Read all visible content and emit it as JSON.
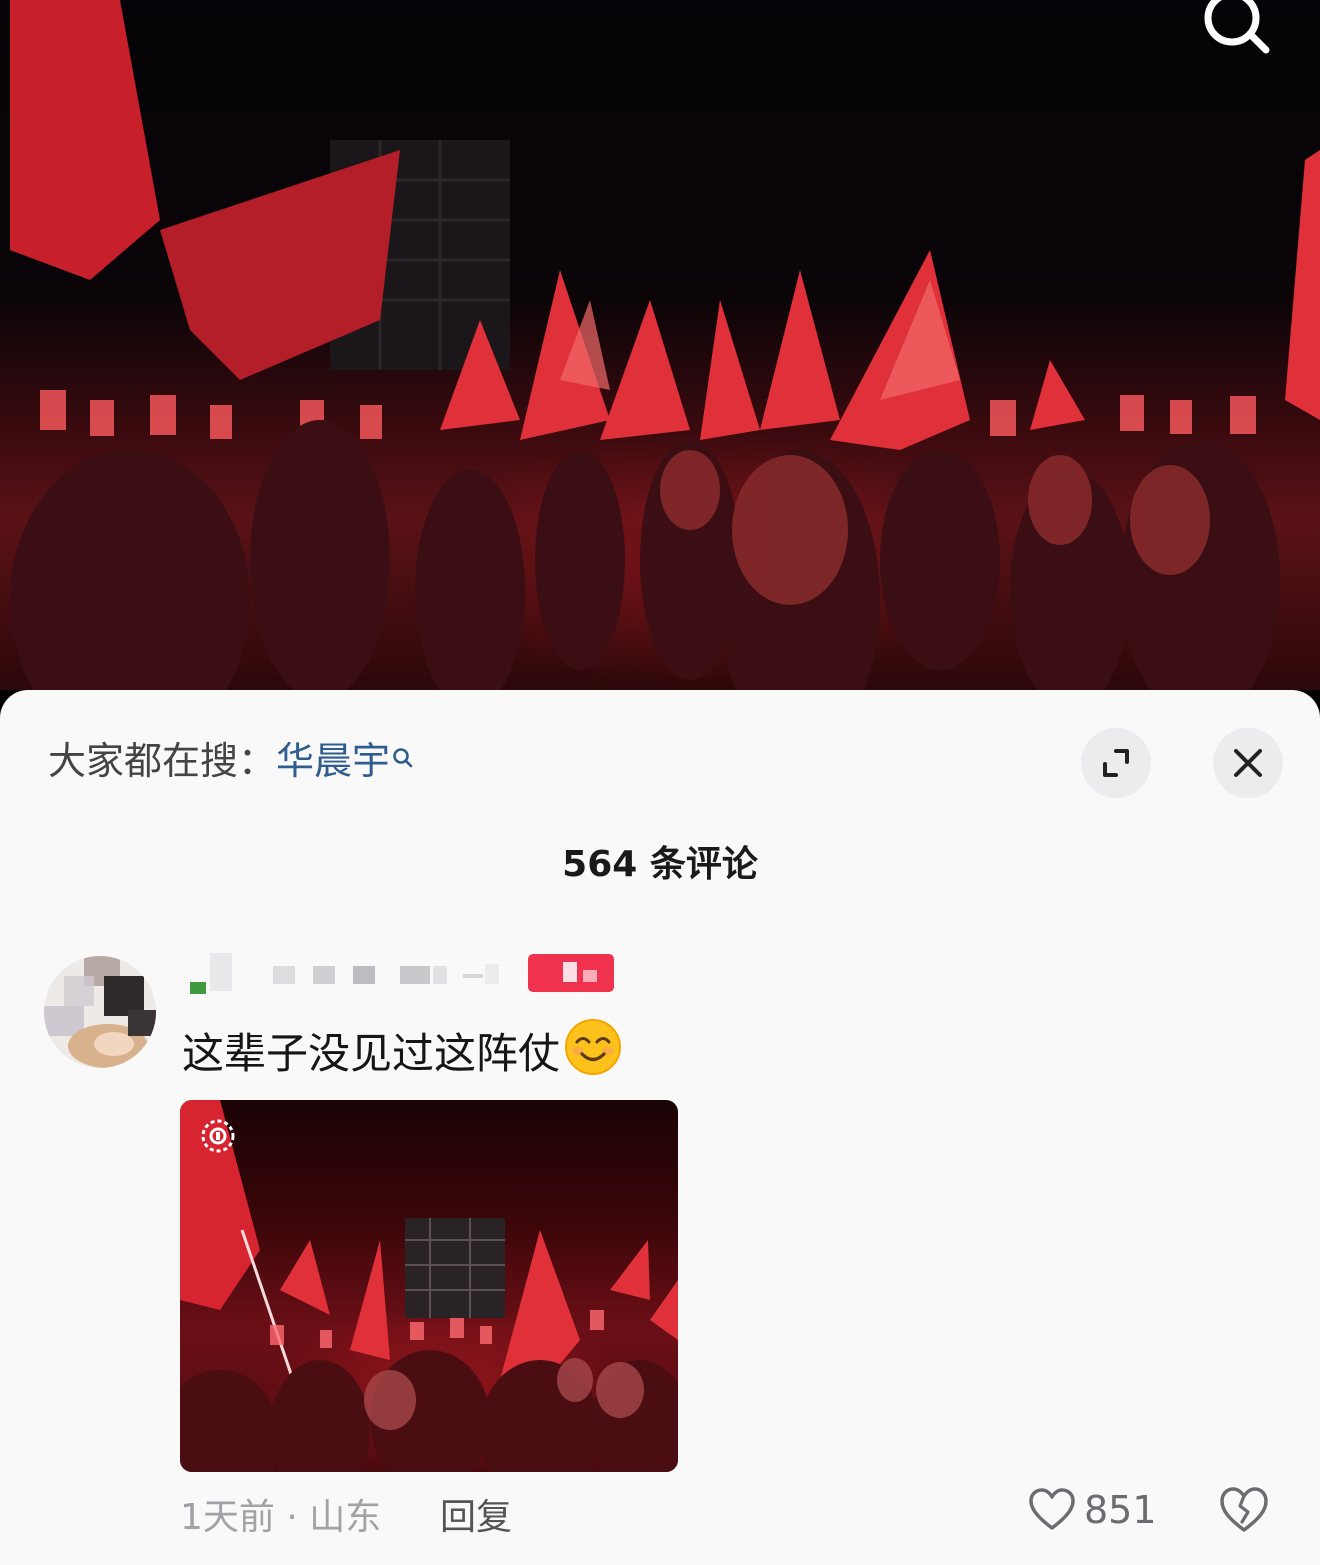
{
  "video": {
    "search_icon": "search-icon"
  },
  "sheet": {
    "trending_prefix": "大家都在搜：",
    "trending_keyword": "华晨宇",
    "expand_icon": "expand-icon",
    "close_icon": "close-icon",
    "comment_count": "564 条评论"
  },
  "comment": {
    "text": "这辈子没见过这阵仗",
    "emoji": "smiling-face-emoji",
    "time": "1天前",
    "separator": " · ",
    "location": "山东",
    "reply_label": "回复",
    "like_count": "851",
    "like_icon": "heart-outline-icon",
    "dislike_icon": "broken-heart-icon"
  },
  "colors": {
    "keyword": "#2f5e8e",
    "sheet_bg": "#f9f9fa",
    "flag_red": "#d9232c"
  }
}
